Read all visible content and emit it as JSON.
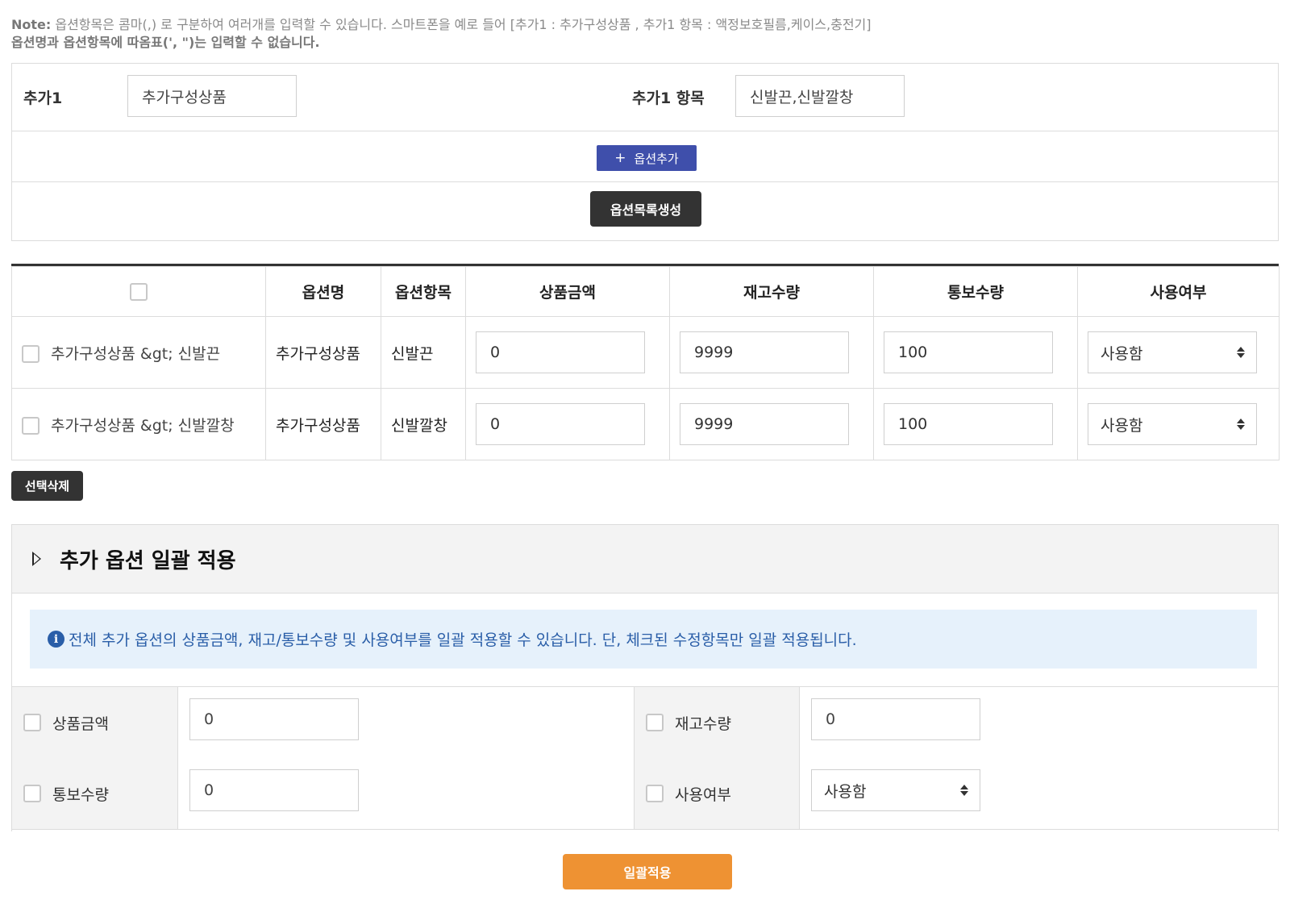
{
  "note": {
    "prefix": "Note:",
    "line1": " 옵션항목은 콤마(,) 로 구분하여 여러개를 입력할 수 있습니다. 스마트폰을 예로 들어 [추가1 : 추가구성상품 , 추가1 항목 : 액정보호필름,케이스,충전기]",
    "line2": "옵션명과 옵션항목에 따옴표(', \")는 입력할 수 없습니다."
  },
  "setup": {
    "name_label": "추가1",
    "name_value": "추가구성상품",
    "items_label": "추가1 항목",
    "items_value": "신발끈,신발깔창",
    "add_option_label": "옵션추가",
    "generate_label": "옵션목록생성"
  },
  "table": {
    "headers": [
      "옵션명",
      "옵션항목",
      "상품금액",
      "재고수량",
      "통보수량",
      "사용여부"
    ],
    "rows": [
      {
        "full": "추가구성상품 &gt; 신발끈",
        "name": "추가구성상품",
        "item": "신발끈",
        "price": "0",
        "stock": "9999",
        "notify": "100",
        "use": "사용함"
      },
      {
        "full": "추가구성상품 &gt; 신발깔창",
        "name": "추가구성상품",
        "item": "신발깔창",
        "price": "0",
        "stock": "9999",
        "notify": "100",
        "use": "사용함"
      }
    ]
  },
  "delete_selected_label": "선택삭제",
  "bulk": {
    "title": "추가 옵션 일괄 적용",
    "info": "전체 추가 옵션의 상품금액, 재고/통보수량 및 사용여부를 일괄 적용할 수 있습니다. 단, 체크된 수정항목만 일괄 적용됩니다.",
    "price_label": "상품금액",
    "price_value": "0",
    "stock_label": "재고수량",
    "stock_value": "0",
    "notify_label": "통보수량",
    "notify_value": "0",
    "use_label": "사용여부",
    "use_value": "사용함",
    "apply_label": "일괄적용"
  },
  "colors": {
    "add_button": "#3f4fab",
    "dark_button": "#333333",
    "apply_button": "#ee9233",
    "info_bg": "#e6f1fb",
    "info_text": "#2a5ea8"
  }
}
